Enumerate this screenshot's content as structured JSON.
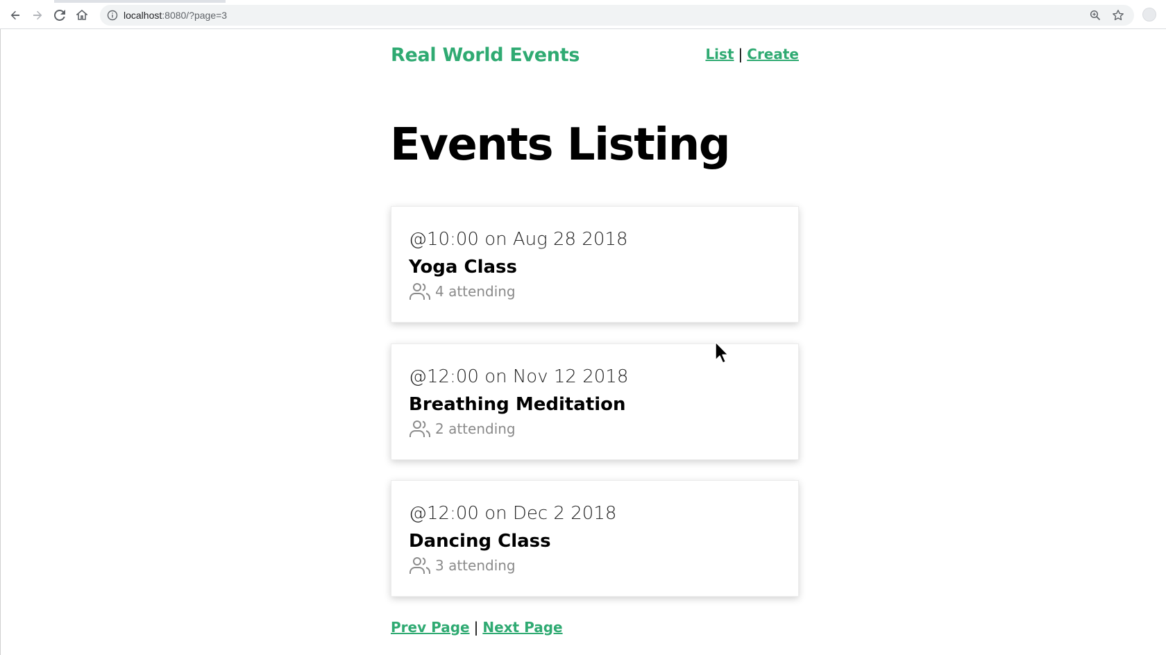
{
  "browser": {
    "url_host": "localhost",
    "url_rest": ":8080/?page=3"
  },
  "site": {
    "brand": "Real World Events",
    "nav": {
      "list_label": "List",
      "separator": "|",
      "create_label": "Create"
    },
    "accent_color": "#2faa72"
  },
  "main": {
    "title": "Events Listing",
    "events": [
      {
        "time": "@10:00 on Aug 28 2018",
        "title": "Yoga Class",
        "attending": "4 attending"
      },
      {
        "time": "@12:00 on Nov 12 2018",
        "title": "Breathing Meditation",
        "attending": "2 attending"
      },
      {
        "time": "@12:00 on Dec 2 2018",
        "title": "Dancing Class",
        "attending": "3 attending"
      }
    ]
  },
  "pager": {
    "prev_label": "Prev Page",
    "separator": "|",
    "next_label": "Next Page"
  }
}
